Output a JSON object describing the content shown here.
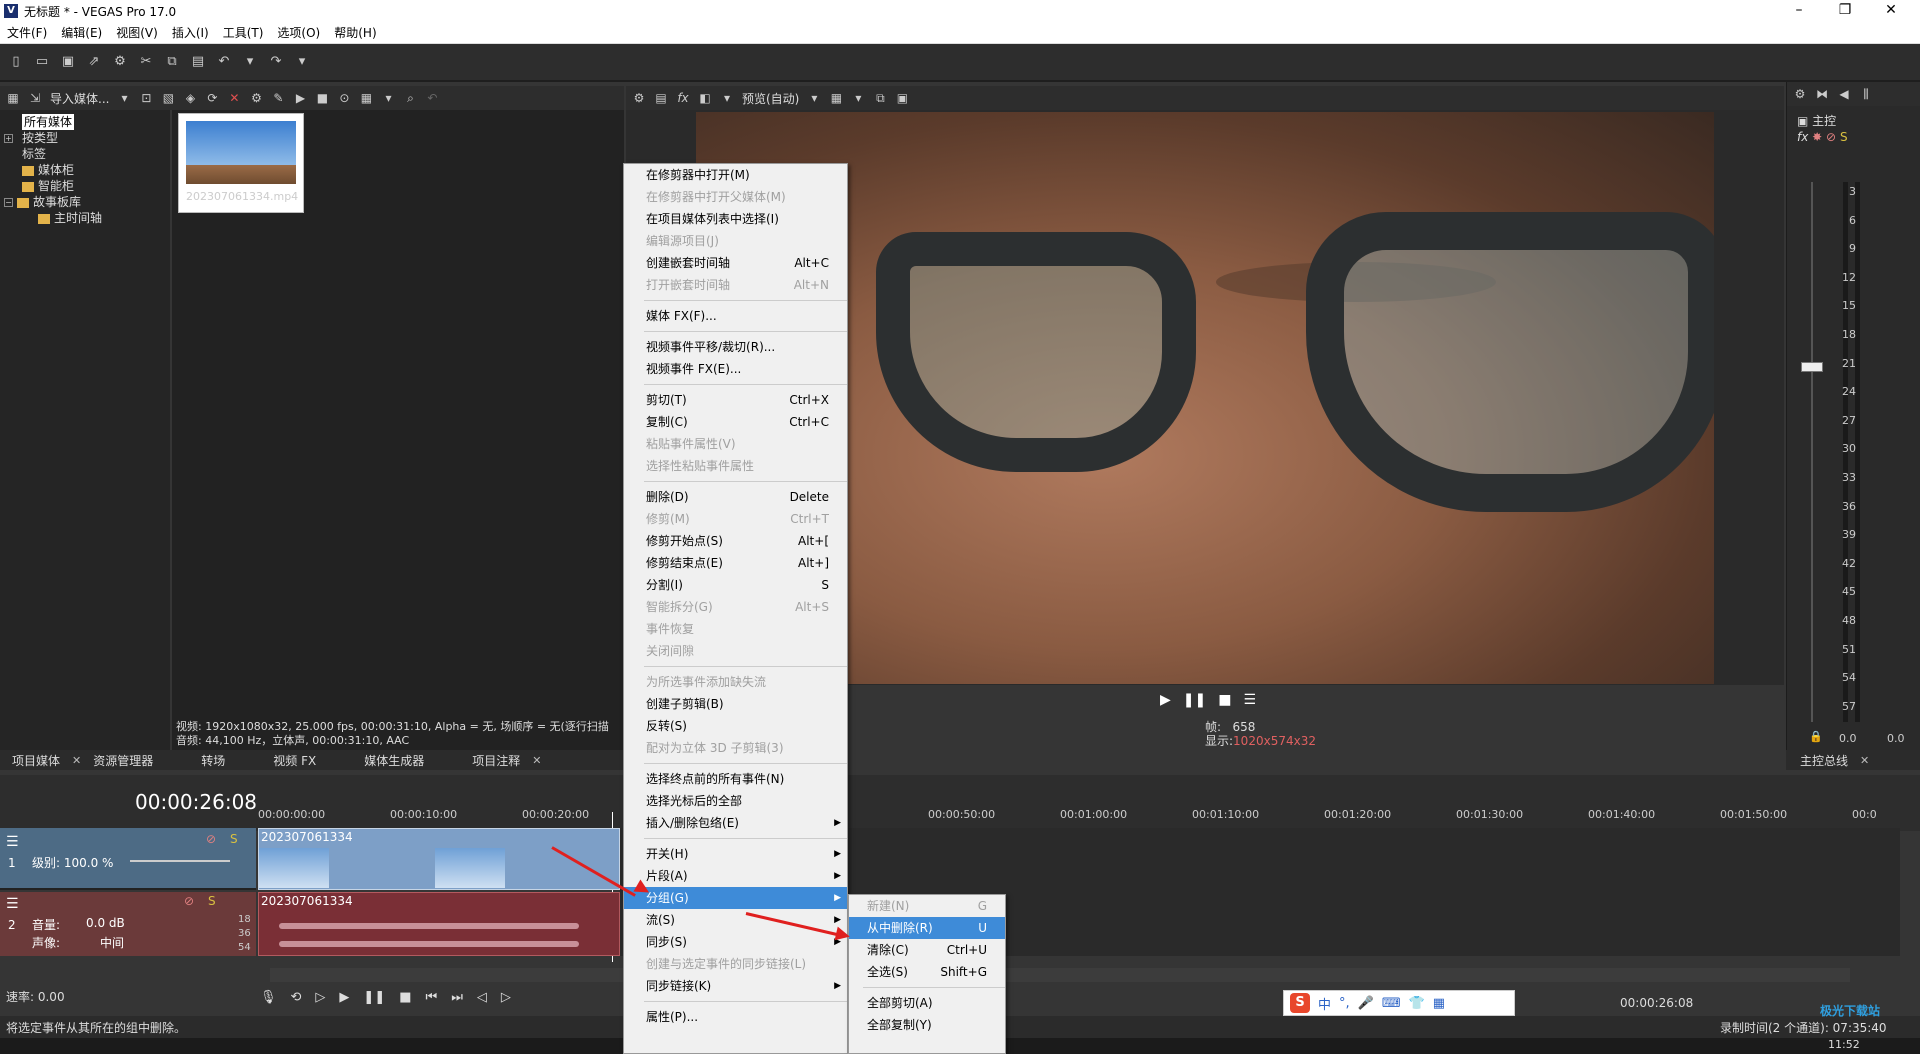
{
  "window": {
    "title": "无标题 * - VEGAS Pro 17.0",
    "logo": "V"
  },
  "menu": [
    "文件(F)",
    "编辑(E)",
    "视图(V)",
    "插入(I)",
    "工具(T)",
    "选项(O)",
    "帮助(H)"
  ],
  "explorer": {
    "import_label": "导入媒体...",
    "tree": [
      "所有媒体",
      "按类型",
      "标签",
      "媒体柜",
      "智能柜",
      "故事板库",
      "主时间轴"
    ],
    "file_name": "202307061334.mp4",
    "info_video": "视频: 1920x1080x32, 25.000 fps, 00:00:31:10, Alpha = 无, 场顺序 = 无(逐行扫描",
    "info_audio": "音频: 44,100 Hz，立体声, 00:00:31:10, AAC"
  },
  "bottom_tabs": [
    "项目媒体",
    "资源管理器",
    "转场",
    "视频 FX",
    "媒体生成器",
    "项目注释"
  ],
  "preview": {
    "mode_label": "预览(自动)",
    "frame_label": "帧:",
    "frame_value": "658",
    "display_label": "显示:",
    "display_value": "1020x574x32"
  },
  "master": {
    "title": "主控",
    "tab": "主控总线",
    "scale": [
      "3",
      "6",
      "9",
      "12",
      "15",
      "18",
      "21",
      "24",
      "27",
      "30",
      "33",
      "36",
      "39",
      "42",
      "45",
      "48",
      "51",
      "54",
      "57"
    ],
    "readout_left": "0.0",
    "readout_right": "0.0"
  },
  "timeline": {
    "timecode": "00:00:26:08",
    "ruler": [
      "00:00:00:00",
      "00:00:10:00",
      "00:00:20:00",
      "00:00:50:00",
      "00:01:00:00",
      "00:01:10:00",
      "00:01:20:00",
      "00:01:30:00",
      "00:01:40:00",
      "00:01:50:00",
      "00:0"
    ],
    "track1": {
      "number": "1",
      "level": "级别: 100.0 %",
      "clip": "202307061334"
    },
    "track2": {
      "number": "2",
      "volume_label": "音量:",
      "volume_value": "0.0 dB",
      "pan_label": "声像:",
      "pan_value": "中间",
      "clip": "202307061334",
      "scale": [
        "18",
        "36",
        "54"
      ]
    },
    "rate": "速率: 0.00",
    "end_timecode": "00:00:26:08"
  },
  "context_menu": [
    {
      "label": "在修剪器中打开(M)",
      "disabled": false
    },
    {
      "label": "在修剪器中打开父媒体(M)",
      "disabled": true
    },
    {
      "label": "在项目媒体列表中选择(I)",
      "disabled": false
    },
    {
      "label": "编辑源项目(J)",
      "disabled": true
    },
    {
      "label": "创建嵌套时间轴",
      "shortcut": "Alt+C",
      "disabled": false
    },
    {
      "label": "打开嵌套时间轴",
      "shortcut": "Alt+N",
      "disabled": true
    },
    {
      "sep": true
    },
    {
      "label": "媒体 FX(F)...",
      "disabled": false
    },
    {
      "sep": true
    },
    {
      "label": "视频事件平移/裁切(R)...",
      "disabled": false
    },
    {
      "label": "视频事件 FX(E)...",
      "disabled": false
    },
    {
      "sep": true
    },
    {
      "label": "剪切(T)",
      "shortcut": "Ctrl+X",
      "disabled": false
    },
    {
      "label": "复制(C)",
      "shortcut": "Ctrl+C",
      "disabled": false
    },
    {
      "label": "粘贴事件属性(V)",
      "disabled": true
    },
    {
      "label": "选择性粘贴事件属性",
      "disabled": true
    },
    {
      "sep": true
    },
    {
      "label": "删除(D)",
      "shortcut": "Delete",
      "disabled": false
    },
    {
      "label": "修剪(M)",
      "shortcut": "Ctrl+T",
      "disabled": true
    },
    {
      "label": "修剪开始点(S)",
      "shortcut": "Alt+[",
      "disabled": false
    },
    {
      "label": "修剪结束点(E)",
      "shortcut": "Alt+]",
      "disabled": false
    },
    {
      "label": "分割(I)",
      "shortcut": "S",
      "disabled": false
    },
    {
      "label": "智能拆分(G)",
      "shortcut": "Alt+S",
      "disabled": true
    },
    {
      "label": "事件恢复",
      "disabled": true
    },
    {
      "label": "关闭间隙",
      "disabled": true
    },
    {
      "sep": true
    },
    {
      "label": "为所选事件添加缺失流",
      "disabled": true
    },
    {
      "label": "创建子剪辑(B)",
      "disabled": false
    },
    {
      "label": "反转(S)",
      "disabled": false
    },
    {
      "label": "配对为立体 3D 子剪辑(3)",
      "disabled": true
    },
    {
      "sep": true
    },
    {
      "label": "选择终点前的所有事件(N)",
      "disabled": false
    },
    {
      "label": "选择光标后的全部",
      "disabled": false
    },
    {
      "label": "插入/删除包络(E)",
      "submenu": true,
      "disabled": false
    },
    {
      "sep": true
    },
    {
      "label": "开关(H)",
      "submenu": true,
      "disabled": false
    },
    {
      "label": "片段(A)",
      "submenu": true,
      "disabled": false
    },
    {
      "label": "分组(G)",
      "submenu": true,
      "highlight": true,
      "disabled": false
    },
    {
      "label": "流(S)",
      "submenu": true,
      "disabled": false
    },
    {
      "label": "同步(S)",
      "submenu": true,
      "disabled": false
    },
    {
      "label": "创建与选定事件的同步链接(L)",
      "disabled": true
    },
    {
      "label": "同步链接(K)",
      "submenu": true,
      "disabled": false
    },
    {
      "sep": true
    },
    {
      "label": "属性(P)...",
      "disabled": false
    }
  ],
  "submenu": [
    {
      "label": "新建(N)",
      "shortcut": "G",
      "disabled": true
    },
    {
      "label": "从中删除(R)",
      "shortcut": "U",
      "highlight": true
    },
    {
      "label": "清除(C)",
      "shortcut": "Ctrl+U"
    },
    {
      "label": "全选(S)",
      "shortcut": "Shift+G"
    },
    {
      "sep": true
    },
    {
      "label": "全部剪切(A)"
    },
    {
      "label": "全部复制(Y)"
    }
  ],
  "ime": {
    "logo": "S",
    "lang": "中"
  },
  "status": {
    "text": "将选定事件从其所在的组中删除。",
    "record_time": "录制时间(2 个通道): 07:35:40",
    "clock": "11:52"
  },
  "watermark": "极光下载站"
}
